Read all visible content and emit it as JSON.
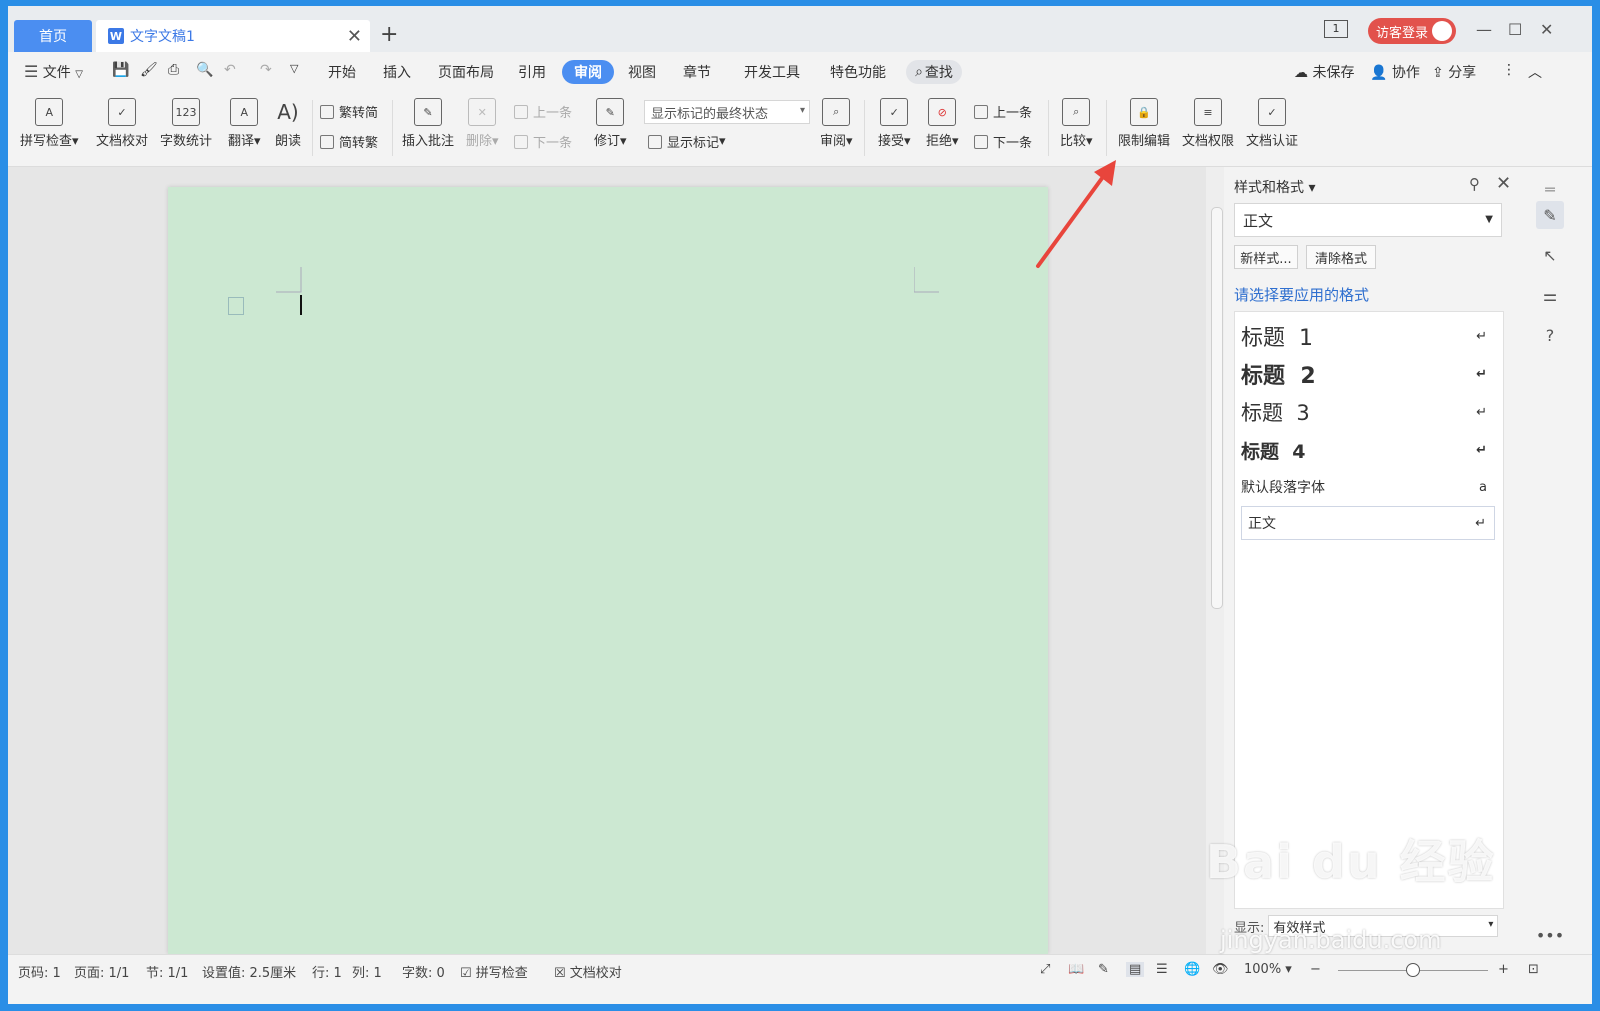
{
  "tabs": {
    "home": "首页",
    "doc_title": "文字文稿1",
    "doc_icon": "W"
  },
  "titlebar": {
    "login": "访客登录",
    "page_indicator": "1"
  },
  "menu": {
    "file": "文件",
    "items": [
      "开始",
      "插入",
      "页面布局",
      "引用",
      "审阅",
      "视图",
      "章节",
      "开发工具",
      "特色功能"
    ],
    "active": "审阅",
    "find": "查找",
    "unsaved": "未保存",
    "collab": "协作",
    "share": "分享"
  },
  "ribbon": {
    "spell": "拼写检查",
    "doc_check": "文档校对",
    "word_count": "字数统计",
    "translate": "翻译",
    "read_aloud": "朗读",
    "trad_to_simp": "繁转简",
    "simp_to_trad": "简转繁",
    "insert_comment": "插入批注",
    "delete": "删除",
    "prev_comment": "上一条",
    "next_comment": "下一条",
    "track": "修订",
    "markup_state": "显示标记的最终状态",
    "show_markup": "显示标记",
    "review": "审阅",
    "accept": "接受",
    "reject": "拒绝",
    "prev_change": "上一条",
    "next_change": "下一条",
    "compare": "比较",
    "restrict_edit": "限制编辑",
    "doc_permission": "文档权限",
    "doc_cert": "文档认证"
  },
  "pane": {
    "title": "样式和格式",
    "current_style": "正文",
    "new_style": "新样式...",
    "clear_format": "清除格式",
    "hint": "请选择要应用的格式",
    "styles": [
      {
        "label": "标题  1",
        "mark": "↵"
      },
      {
        "label": "标题  2",
        "mark": "↵"
      },
      {
        "label": "标题  3",
        "mark": "↵"
      },
      {
        "label": "标题  4",
        "mark": "↵"
      },
      {
        "label": "默认段落字体",
        "mark": "a"
      },
      {
        "label": "正文",
        "mark": "↵"
      }
    ],
    "show_label": "显示:",
    "show_value": "有效样式"
  },
  "status": {
    "page_no": "页码: 1",
    "pages": "页面: 1/1",
    "section": "节: 1/1",
    "setting": "设置值: 2.5厘米",
    "row": "行: 1",
    "col": "列: 1",
    "words": "字数: 0",
    "spell": "拼写检查",
    "doc_check": "文档校对",
    "zoom": "100%"
  },
  "watermark": {
    "logo": "Bai du 经验",
    "url": "jingyan.baidu.com"
  },
  "colors": {
    "accent": "#4b8ef1",
    "page_bg": "#cce8d2",
    "login_btn": "#e2524c",
    "arrow": "#e8453c"
  }
}
